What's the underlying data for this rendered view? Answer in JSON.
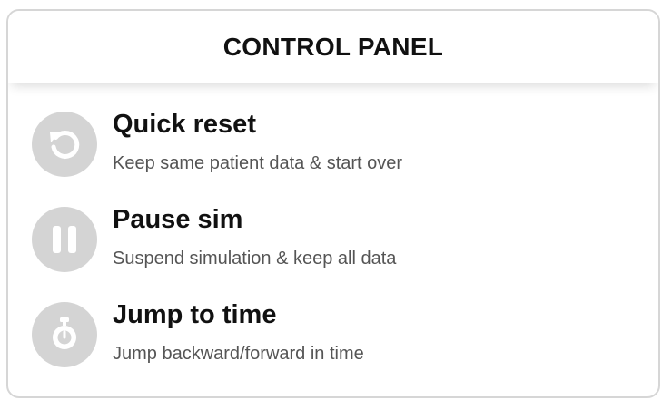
{
  "panel": {
    "title": "CONTROL PANEL"
  },
  "items": [
    {
      "icon": "restart-icon",
      "title": "Quick reset",
      "description": "Keep same patient data & start over"
    },
    {
      "icon": "pause-icon",
      "title": "Pause sim",
      "description": "Suspend simulation & keep all data"
    },
    {
      "icon": "stopwatch-icon",
      "title": "Jump to time",
      "description": "Jump backward/forward in time"
    }
  ],
  "colors": {
    "icon_background": "#d4d4d4",
    "icon_foreground": "#ffffff",
    "title_text": "#111111",
    "description_text": "#555555",
    "border": "#d6d6d6"
  }
}
